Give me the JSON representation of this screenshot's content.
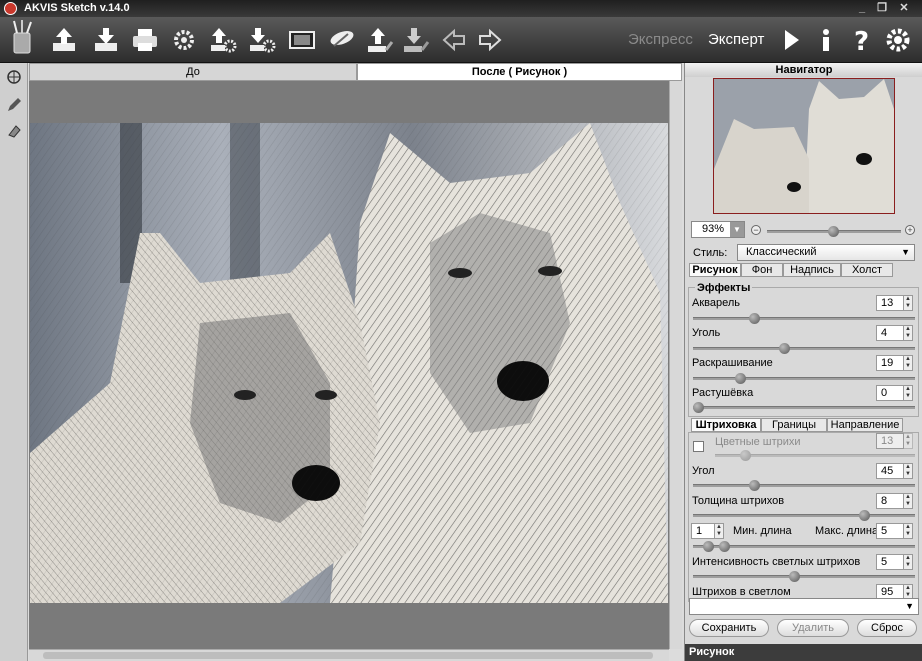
{
  "window": {
    "title": "AKVIS Sketch v.14.0"
  },
  "toolbar": {
    "buttons": [
      "open-icon",
      "save-icon",
      "print-icon",
      "settings-icon",
      "batch-upload-icon",
      "batch-download-icon",
      "filmstrip-icon",
      "presets-icon",
      "share-icon",
      "import-icon",
      "back-icon",
      "forward-icon"
    ],
    "mode_express": "Экспресс",
    "mode_expert": "Эксперт"
  },
  "view_tabs": {
    "before": "До",
    "after": "После ( Рисунок )"
  },
  "navigator": {
    "title": "Навигатор",
    "zoom": "93%"
  },
  "style": {
    "label": "Стиль:",
    "value": "Классический"
  },
  "panel_tabs": [
    "Рисунок",
    "Фон",
    "Надпись",
    "Холст"
  ],
  "effects": {
    "title": "Эффекты",
    "params": [
      {
        "label": "Акварель",
        "value": "13",
        "level": 0.33
      },
      {
        "label": "Уголь",
        "value": "4",
        "level": 0.4
      },
      {
        "label": "Раскрашивание",
        "value": "19",
        "level": 0.2
      },
      {
        "label": "Растушёвка",
        "value": "0",
        "level": 0.0
      }
    ]
  },
  "stroke_tabs": [
    "Штриховка",
    "Границы",
    "Направление"
  ],
  "strokes": {
    "colored_label": "Цветные штрихи",
    "colored_value": "13",
    "angle_label": "Угол",
    "angle_value": "45",
    "thickness_label": "Толщина штрихов",
    "thickness_value": "8",
    "min_value": "1",
    "min_label": "Мин. длина",
    "max_label": "Макс. длина",
    "max_value": "5",
    "intensity_label": "Интенсивность светлых штрихов",
    "intensity_value": "5",
    "light_label": "Штрихов в светлом",
    "light_value": "95",
    "overlay_label": "Штрихов в светлом"
  },
  "buttons": {
    "save": "Сохранить",
    "delete": "Удалить",
    "reset": "Сброс"
  },
  "footer": "Рисунок"
}
